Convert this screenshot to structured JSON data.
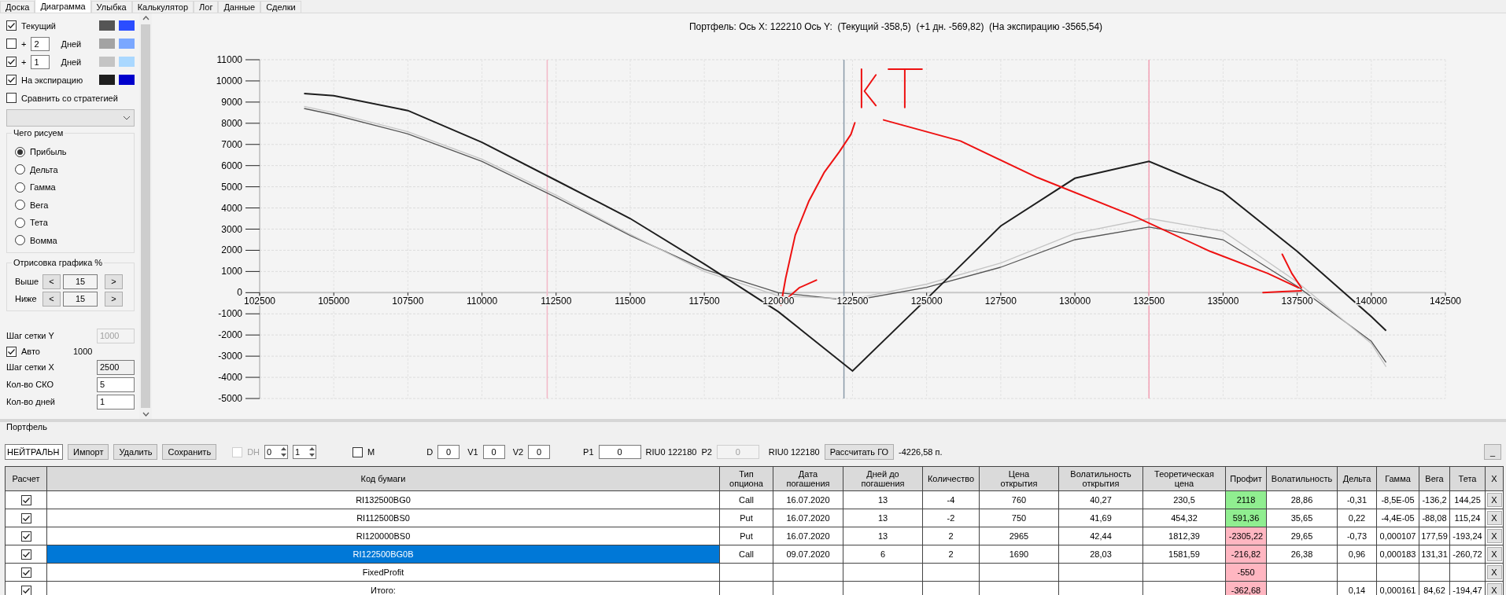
{
  "tabs": [
    {
      "label": "Доска",
      "selected": false
    },
    {
      "label": "Диаграмма",
      "selected": true
    },
    {
      "label": "Улыбка",
      "selected": false
    },
    {
      "label": "Калькулятор",
      "selected": false
    },
    {
      "label": "Лог",
      "selected": false
    },
    {
      "label": "Данные",
      "selected": false
    },
    {
      "label": "Сделки",
      "selected": false
    }
  ],
  "sidebar": {
    "curves": [
      {
        "kind": "label",
        "checked": true,
        "label": "Текущий",
        "swatches": [
          {
            "color": "#555555"
          },
          {
            "color": "#2b4dff"
          }
        ]
      },
      {
        "kind": "days",
        "checked": false,
        "sign": "+",
        "value": "2",
        "unit": "Дней",
        "swatches": [
          {
            "color": "#a3a3a3"
          },
          {
            "color": "#7aa7ff"
          }
        ]
      },
      {
        "kind": "days",
        "checked": true,
        "sign": "+",
        "value": "1",
        "unit": "Дней",
        "swatches": [
          {
            "color": "#c4c4c4"
          },
          {
            "color": "#aad8ff"
          }
        ]
      },
      {
        "kind": "label",
        "checked": true,
        "label": "На экспирацию",
        "swatches": [
          {
            "color": "#1e1e1e"
          },
          {
            "color": "#0000cc"
          }
        ]
      }
    ],
    "compare": {
      "label": "Сравнить со стратегией",
      "checked": false
    },
    "strategy_dropdown": {
      "disabled": true
    },
    "draw_group": {
      "title": "Чего рисуем",
      "options": [
        {
          "label": "Прибыль",
          "selected": true
        },
        {
          "label": "Дельта",
          "selected": false
        },
        {
          "label": "Гамма",
          "selected": false
        },
        {
          "label": "Вега",
          "selected": false
        },
        {
          "label": "Тета",
          "selected": false
        },
        {
          "label": "Вомма",
          "selected": false
        }
      ]
    },
    "range_group": {
      "title": "Отрисовка графика %",
      "rows": [
        {
          "label": "Выше",
          "dec": "<",
          "value": "15",
          "inc": ">"
        },
        {
          "label": "Ниже",
          "dec": "<",
          "value": "15",
          "inc": ">"
        }
      ]
    },
    "grid_y": {
      "label": "Шаг сетки Y",
      "value": "1000",
      "disabled": true
    },
    "auto": {
      "label": "Авто",
      "checked": true,
      "value": "1000"
    },
    "grid_x": {
      "label": "Шаг сетки X",
      "value": "2500"
    },
    "sko": {
      "label": "Кол-во СКО",
      "value": "5"
    },
    "days": {
      "label": "Кол-во дней",
      "value": "1"
    }
  },
  "chart": {
    "title": "Портфель: Ось X: 122210 Ось Y:  (Текущий -358,5)  (+1 дн. -569,82)  (На экспирацию -3565,54)",
    "chart_data": {
      "type": "line",
      "x": [
        104000,
        105000,
        107500,
        110000,
        112500,
        115000,
        117500,
        120000,
        122500,
        125000,
        127500,
        130000,
        132500,
        135000,
        137500,
        140000,
        140500
      ],
      "series": [
        {
          "color": "#555555",
          "values": [
            8700,
            8400,
            7500,
            6200,
            4500,
            2700,
            1100,
            0,
            -380,
            250,
            1200,
            2500,
            3100,
            2500,
            300,
            -2300,
            -3300
          ]
        },
        {
          "color": "#c4c4c4",
          "values": [
            8800,
            8500,
            7600,
            6300,
            4600,
            2750,
            1000,
            -150,
            -300,
            400,
            1400,
            2800,
            3500,
            2900,
            500,
            -2400,
            -3500
          ]
        },
        {
          "color": "#1e1e1e",
          "values": [
            9400,
            9300,
            8600,
            7100,
            5300,
            3500,
            1350,
            -900,
            -3700,
            -300,
            3150,
            5400,
            6200,
            4750,
            1950,
            -1130,
            -1800
          ]
        }
      ],
      "xlim": [
        102500,
        142500
      ],
      "ylim": [
        -5000,
        11000
      ],
      "xticks": [
        102500,
        105000,
        107500,
        110000,
        112500,
        115000,
        117500,
        120000,
        122500,
        125000,
        127500,
        130000,
        132500,
        135000,
        137500,
        140000,
        142500
      ],
      "yticks": [
        11000,
        10000,
        9000,
        8000,
        7000,
        6000,
        5000,
        4000,
        3000,
        2000,
        1000,
        0,
        -1000,
        -2000,
        -3000,
        -4000,
        -5000
      ],
      "grid": true,
      "ref_lines": [
        {
          "axis": "x",
          "value": 112200,
          "color": "#f2b8c6"
        },
        {
          "axis": "x",
          "value": 122210,
          "color": "#8a9aa8"
        },
        {
          "axis": "x",
          "value": 132500,
          "color": "#f2a0b4"
        }
      ]
    }
  },
  "portfolio": {
    "title": "Портфель",
    "strategy": "НЕЙТРАЛЬН",
    "buttons": [
      "Импорт",
      "Удалить",
      "Сохранить"
    ],
    "dh": {
      "label": "DH",
      "checked": false,
      "disabled": true
    },
    "spinners": [
      "0",
      "1"
    ],
    "m": {
      "label": "M",
      "checked": false
    },
    "params": [
      {
        "label": "D",
        "value": "0"
      },
      {
        "label": "V1",
        "value": "0"
      },
      {
        "label": "V2",
        "value": "0"
      }
    ],
    "p1": {
      "label": "P1",
      "value": "0"
    },
    "riu_1": "RIU0 122180",
    "p2": {
      "label": "P2",
      "value": "0",
      "disabled": true
    },
    "riu_2": "RIU0 122180",
    "go_button": "Рассчитать ГО",
    "go_value": "-4226,58 п.",
    "minimize": "_"
  },
  "table": {
    "columns": [
      "Расчет",
      "Код бумаги",
      "Тип\nопциона",
      "Дата\nпогашения",
      "Дней до\nпогашения",
      "Количество",
      "Цена\nоткрытия",
      "Волатильность\nоткрытия",
      "Теоретическая\nцена",
      "Профит",
      "Волатильность",
      "Дельта",
      "Гамма",
      "Вега",
      "Тета",
      "X"
    ],
    "rows": [
      {
        "checked": true,
        "selected": false,
        "color": "#90ee90",
        "cells": [
          null,
          "RI132500BG0",
          "Call",
          "16.07.2020",
          "13",
          "-4",
          "760",
          "40,27",
          "230,5",
          "2118",
          "28,86",
          "-0,31",
          "-8,5E-05",
          "-136,2",
          "144,25",
          "X"
        ]
      },
      {
        "checked": true,
        "selected": false,
        "color": "#90ee90",
        "cells": [
          null,
          "RI112500BS0",
          "Put",
          "16.07.2020",
          "13",
          "-2",
          "750",
          "41,69",
          "454,32",
          "591,36",
          "35,65",
          "0,22",
          "-4,4E-05",
          "-88,08",
          "115,24",
          "X"
        ]
      },
      {
        "checked": true,
        "selected": false,
        "color": "#ffb6c1",
        "cells": [
          null,
          "RI120000BS0",
          "Put",
          "16.07.2020",
          "13",
          "2",
          "2965",
          "42,44",
          "1812,39",
          "-2305,22",
          "29,65",
          "-0,73",
          "0,000107",
          "177,59",
          "-193,24",
          "X"
        ]
      },
      {
        "checked": true,
        "selected": true,
        "color": "#ffb6c1",
        "cells": [
          null,
          "RI122500BG0B",
          "Call",
          "09.07.2020",
          "6",
          "2",
          "1690",
          "28,03",
          "1581,59",
          "-216,82",
          "26,38",
          "0,96",
          "0,000183",
          "131,31",
          "-260,72",
          "X"
        ]
      },
      {
        "checked": true,
        "selected": false,
        "color": "#ffb6c1",
        "cells": [
          null,
          "FixedProfit",
          null,
          null,
          null,
          null,
          null,
          null,
          null,
          "-550",
          null,
          null,
          null,
          null,
          null,
          "X"
        ]
      },
      {
        "checked": true,
        "selected": false,
        "color": "#ffb6c1",
        "cells": [
          null,
          "Итого:",
          null,
          null,
          null,
          null,
          null,
          null,
          null,
          "-362,68",
          null,
          "0,14",
          "0,000161",
          "84,62",
          "-194,47",
          "X"
        ]
      }
    ]
  }
}
